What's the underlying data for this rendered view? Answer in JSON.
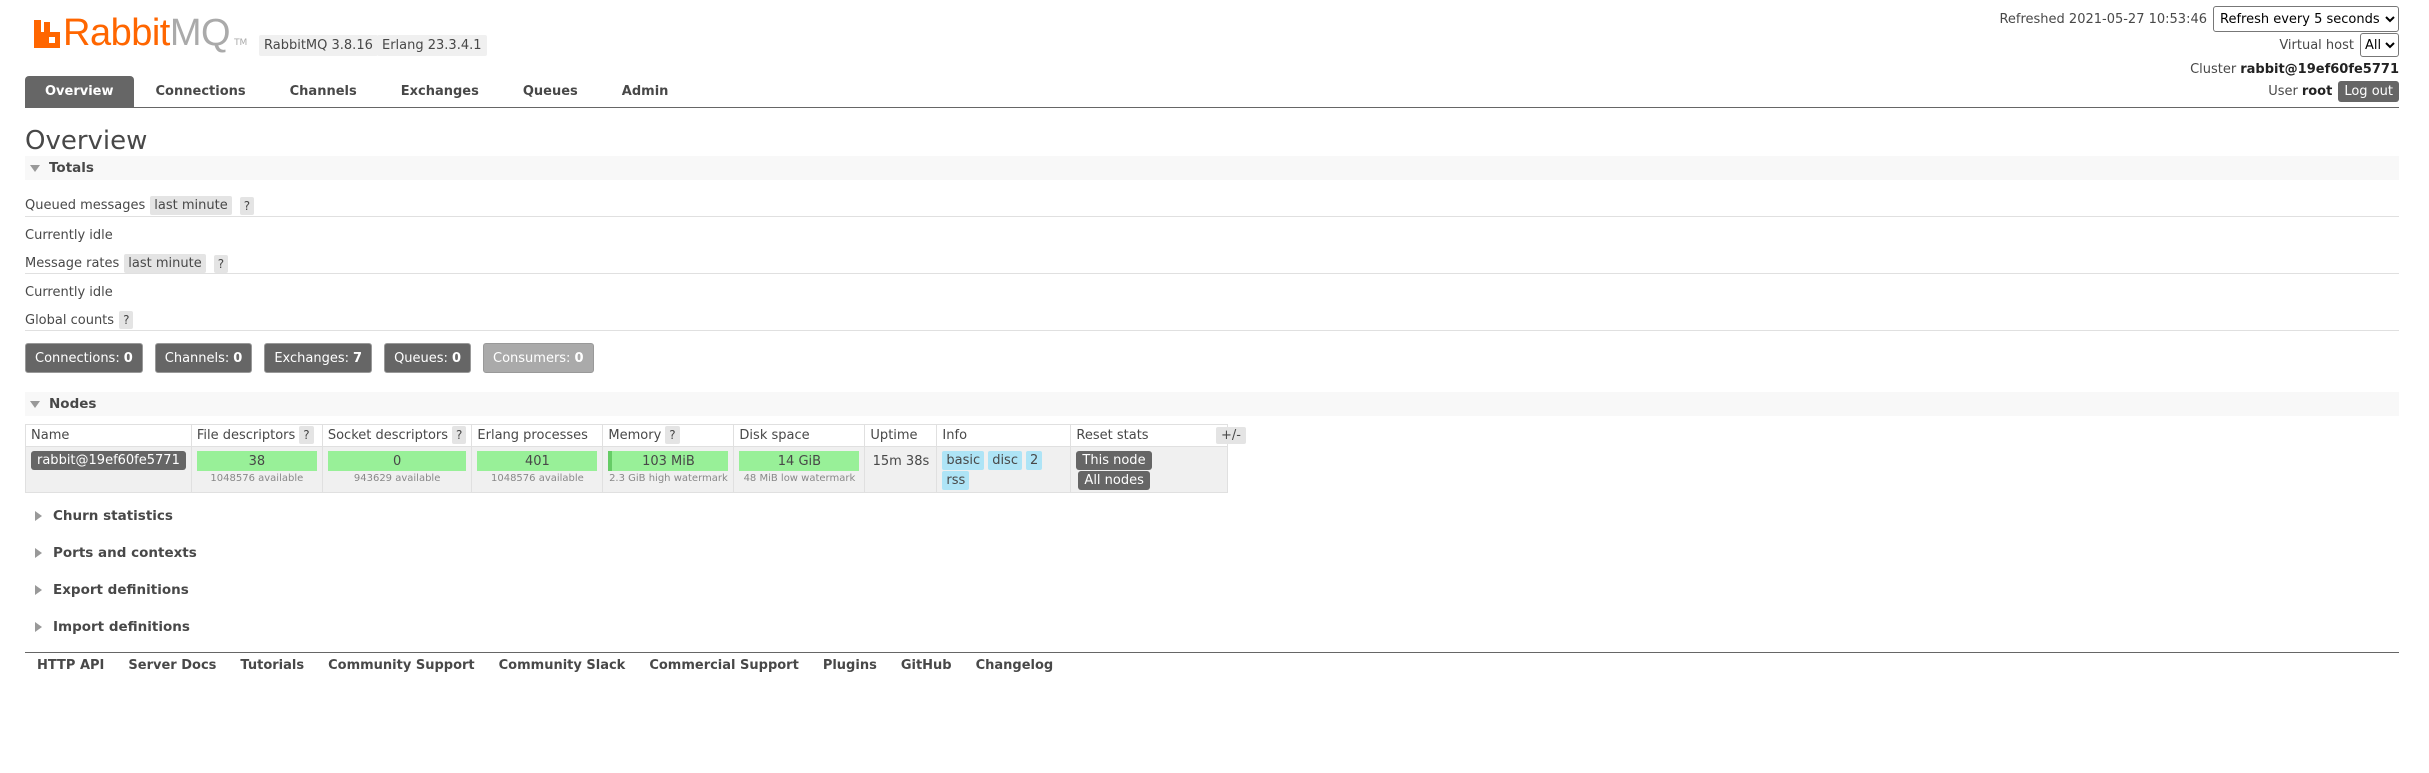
{
  "header": {
    "logo_rabbit": "Rabbit",
    "logo_mq": "MQ",
    "logo_tm": "TM",
    "rabbitmq_version": "RabbitMQ 3.8.16",
    "erlang_version": "Erlang 23.3.4.1",
    "refreshed_label": "Refreshed 2021-05-27 10:53:46",
    "refresh_select": "Refresh every 5 seconds",
    "vhost_label": "Virtual host",
    "vhost_select": "All",
    "cluster_label": "Cluster",
    "cluster_name": "rabbit@19ef60fe5771",
    "user_label": "User",
    "user_name": "root",
    "logout": "Log out"
  },
  "tabs": [
    {
      "label": "Overview",
      "active": true
    },
    {
      "label": "Connections"
    },
    {
      "label": "Channels"
    },
    {
      "label": "Exchanges"
    },
    {
      "label": "Queues"
    },
    {
      "label": "Admin"
    }
  ],
  "page_title": "Overview",
  "totals": {
    "header": "Totals",
    "queued_label": "Queued messages",
    "queued_range": "last minute",
    "help": "?",
    "queued_status": "Currently idle",
    "rates_label": "Message rates",
    "rates_range": "last minute",
    "rates_status": "Currently idle",
    "global_label": "Global counts"
  },
  "counts": [
    {
      "label": "Connections:",
      "value": "0"
    },
    {
      "label": "Channels:",
      "value": "0"
    },
    {
      "label": "Exchanges:",
      "value": "7"
    },
    {
      "label": "Queues:",
      "value": "0"
    },
    {
      "label": "Consumers:",
      "value": "0"
    }
  ],
  "nodes": {
    "header": "Nodes",
    "columns": [
      "Name",
      "File descriptors",
      "Socket descriptors",
      "Erlang processes",
      "Memory",
      "Disk space",
      "Uptime",
      "Info",
      "Reset stats"
    ],
    "toggle": "+/-",
    "row": {
      "name": "rabbit@19ef60fe5771",
      "fd": "38",
      "fd_sub": "1048576 available",
      "sockets": "0",
      "sockets_sub": "943629 available",
      "procs": "401",
      "procs_sub": "1048576 available",
      "memory": "103 MiB",
      "memory_sub": "2.3 GiB high watermark",
      "disk": "14 GiB",
      "disk_sub": "48 MiB low watermark",
      "uptime": "15m 38s",
      "info": [
        "basic",
        "disc",
        "2",
        "rss"
      ],
      "reset_this": "This node",
      "reset_all": "All nodes"
    }
  },
  "collapsed_sections": [
    "Churn statistics",
    "Ports and contexts",
    "Export definitions",
    "Import definitions"
  ],
  "footer_links": [
    "HTTP API",
    "Server Docs",
    "Tutorials",
    "Community Support",
    "Community Slack",
    "Commercial Support",
    "Plugins",
    "GitHub",
    "Changelog"
  ]
}
